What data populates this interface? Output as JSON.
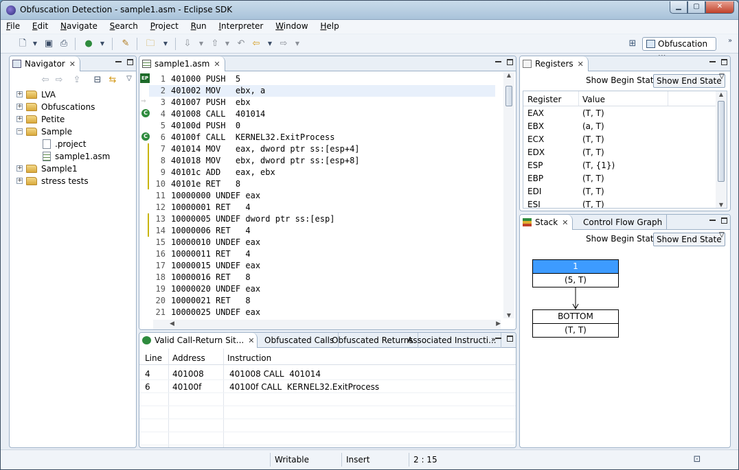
{
  "window": {
    "title": "Obfuscation Detection - sample1.asm - Eclipse SDK"
  },
  "menu": [
    "File",
    "Edit",
    "Navigate",
    "Search",
    "Project",
    "Run",
    "Interpreter",
    "Window",
    "Help"
  ],
  "perspective": {
    "label": "Obfuscation ..."
  },
  "navigator": {
    "title": "Navigator",
    "items": [
      {
        "label": "LVA",
        "kind": "folder",
        "expanded": false
      },
      {
        "label": "Obfuscations",
        "kind": "folder",
        "expanded": false
      },
      {
        "label": "Petite",
        "kind": "folder",
        "expanded": false
      },
      {
        "label": "Sample",
        "kind": "folder",
        "expanded": true
      },
      {
        "label": ".project",
        "kind": "file"
      },
      {
        "label": "sample1.asm",
        "kind": "asm-file"
      },
      {
        "label": "Sample1",
        "kind": "folder",
        "expanded": false
      },
      {
        "label": "stress tests",
        "kind": "folder",
        "expanded": false
      }
    ]
  },
  "editor": {
    "tab": "sample1.asm",
    "lines": [
      "401000 PUSH  5",
      "401002 MOV   ebx, a",
      "401007 PUSH  ebx",
      "401008 CALL  401014",
      "40100d PUSH  0",
      "40100f CALL  KERNEL32.ExitProcess",
      "401014 MOV   eax, dword ptr ss:[esp+4]",
      "401018 MOV   ebx, dword ptr ss:[esp+8]",
      "40101c ADD   eax, ebx",
      "40101e RET   8",
      "10000000 UNDEF eax",
      "10000001 RET   4",
      "10000005 UNDEF dword ptr ss:[esp]",
      "10000006 RET   4",
      "10000010 UNDEF eax",
      "10000011 RET   4",
      "10000015 UNDEF eax",
      "10000016 RET   8",
      "10000020 UNDEF eax",
      "10000021 RET   8",
      "10000025 UNDEF eax"
    ],
    "ep_marker": "EP"
  },
  "bottom_panel": {
    "tabs": [
      "Valid Call-Return Sit...",
      "Obfuscated Calls",
      "Obfuscated Returns",
      "Associated Instructi..."
    ],
    "overflow": "»",
    "columns": [
      "Line",
      "Address",
      "Instruction"
    ],
    "rows": [
      [
        "4",
        "401008",
        "401008 CALL  401014"
      ],
      [
        "6",
        "40100f",
        "40100f CALL  KERNEL32.ExitProcess"
      ]
    ]
  },
  "registers": {
    "title": "Registers",
    "show_begin": "Show Begin State",
    "show_end": "Show End State",
    "columns": [
      "Register",
      "Value"
    ],
    "rows": [
      [
        "EAX",
        "(T, T)"
      ],
      [
        "EBX",
        "(a, T)"
      ],
      [
        "ECX",
        "(T, T)"
      ],
      [
        "EDX",
        "(T, T)"
      ],
      [
        "ESP",
        "(T, {1})"
      ],
      [
        "EBP",
        "(T, T)"
      ],
      [
        "EDI",
        "(T, T)"
      ],
      [
        "ESI",
        "(T, T)"
      ]
    ]
  },
  "stack": {
    "tabs": [
      "Stack",
      "Control Flow Graph"
    ],
    "show_begin": "Show Begin State",
    "show_end": "Show End State",
    "nodes": [
      {
        "head": "1",
        "value": "(5, T)"
      },
      {
        "head": "BOTTOM",
        "value": "(T, T)"
      }
    ]
  },
  "status": {
    "mode": "Writable",
    "insert": "Insert",
    "position": "2 : 15"
  },
  "colors": {
    "selection": "#3d9bff",
    "marker_green": "#2e8b3d",
    "marker_yellow": "#c8b400"
  }
}
